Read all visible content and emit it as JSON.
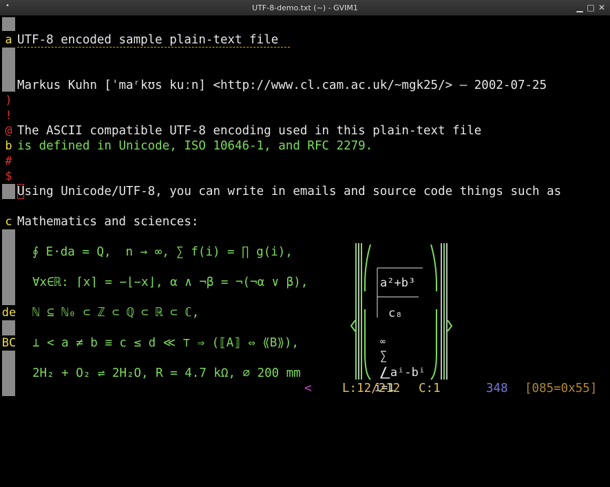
{
  "window": {
    "title": "UTF-8-demo.txt (~) - GVIM1",
    "menu_glyph": "•",
    "minimize": "▁",
    "maximize": "□",
    "close": "✕"
  },
  "colors": {
    "text": "#e6e6e6",
    "green": "#7ddc5b",
    "red": "#e03030",
    "yellow": "#f0e040",
    "fold": "#8a8a8a"
  },
  "gutter": [
    {
      "row": 0,
      "text": "a",
      "color": "yellow"
    },
    {
      "row": 4,
      "text": ")",
      "color": "red"
    },
    {
      "row": 5,
      "text": "!",
      "color": "red"
    },
    {
      "row": 6,
      "text": "@",
      "color": "red"
    },
    {
      "row": 7,
      "text": "b",
      "color": "yellow"
    },
    {
      "row": 8,
      "text": "#",
      "color": "red"
    },
    {
      "row": 9,
      "text": "$",
      "color": "red"
    },
    {
      "row": 13,
      "text": "c",
      "color": "yellow"
    },
    {
      "row": 17,
      "text": "de",
      "color": "yellow"
    },
    {
      "row": 19,
      "text": "BC",
      "color": "yellow"
    }
  ],
  "lines": {
    "title": "UTF-8 encoded sample plain-text file",
    "author": "Markus Kuhn [ˈmaʳkʊs kuːn] <http://www.cl.cam.ac.uk/~mgk25/> — 2002-07-25",
    "ascii1": "The ASCII compatible UTF-8 encoding used in this plain-text file",
    "ascii2": "is defined in Unicode, ISO 10646-1, and RFC 2279.",
    "using": "Using Unicode/UTF-8, you can write in emails and source code things such as",
    "math_heading": "Mathematics and sciences:",
    "math1": "∮ E⋅da = Q,  n → ∞, ∑ f(i) = ∏ g(i),",
    "math2": "∀x∈ℝ: ⌈x⌉ = −⌊−x⌋, α ∧ ¬β = ¬(¬α ∨ β),",
    "math3": "ℕ ⊆ ℕ₀ ⊂ ℤ ⊂ ℚ ⊂ ℝ ⊂ ℂ,",
    "math4": "⊥ < a ≠ b ≡ c ≤ d ≪ ⊤ ⇒ (⟦A⟧ ⇔ ⟪B⟫),",
    "math5": "2H₂ + O₂ ⇌ 2H₂O, R = 4.7 kΩ, ⌀ 200 mm"
  },
  "matrix_art": {
    "numerator": "a²+b³",
    "denominator": "c₈",
    "sum_top": "∞",
    "sum_sign": "∑",
    "sum_body": "⎳aⁱ-bⁱ",
    "sum_bottom": "i=1"
  },
  "status": {
    "arrow": "<",
    "line": "L:12/212",
    "col": "C:1",
    "count": "348",
    "char": "[085=0x55]"
  }
}
